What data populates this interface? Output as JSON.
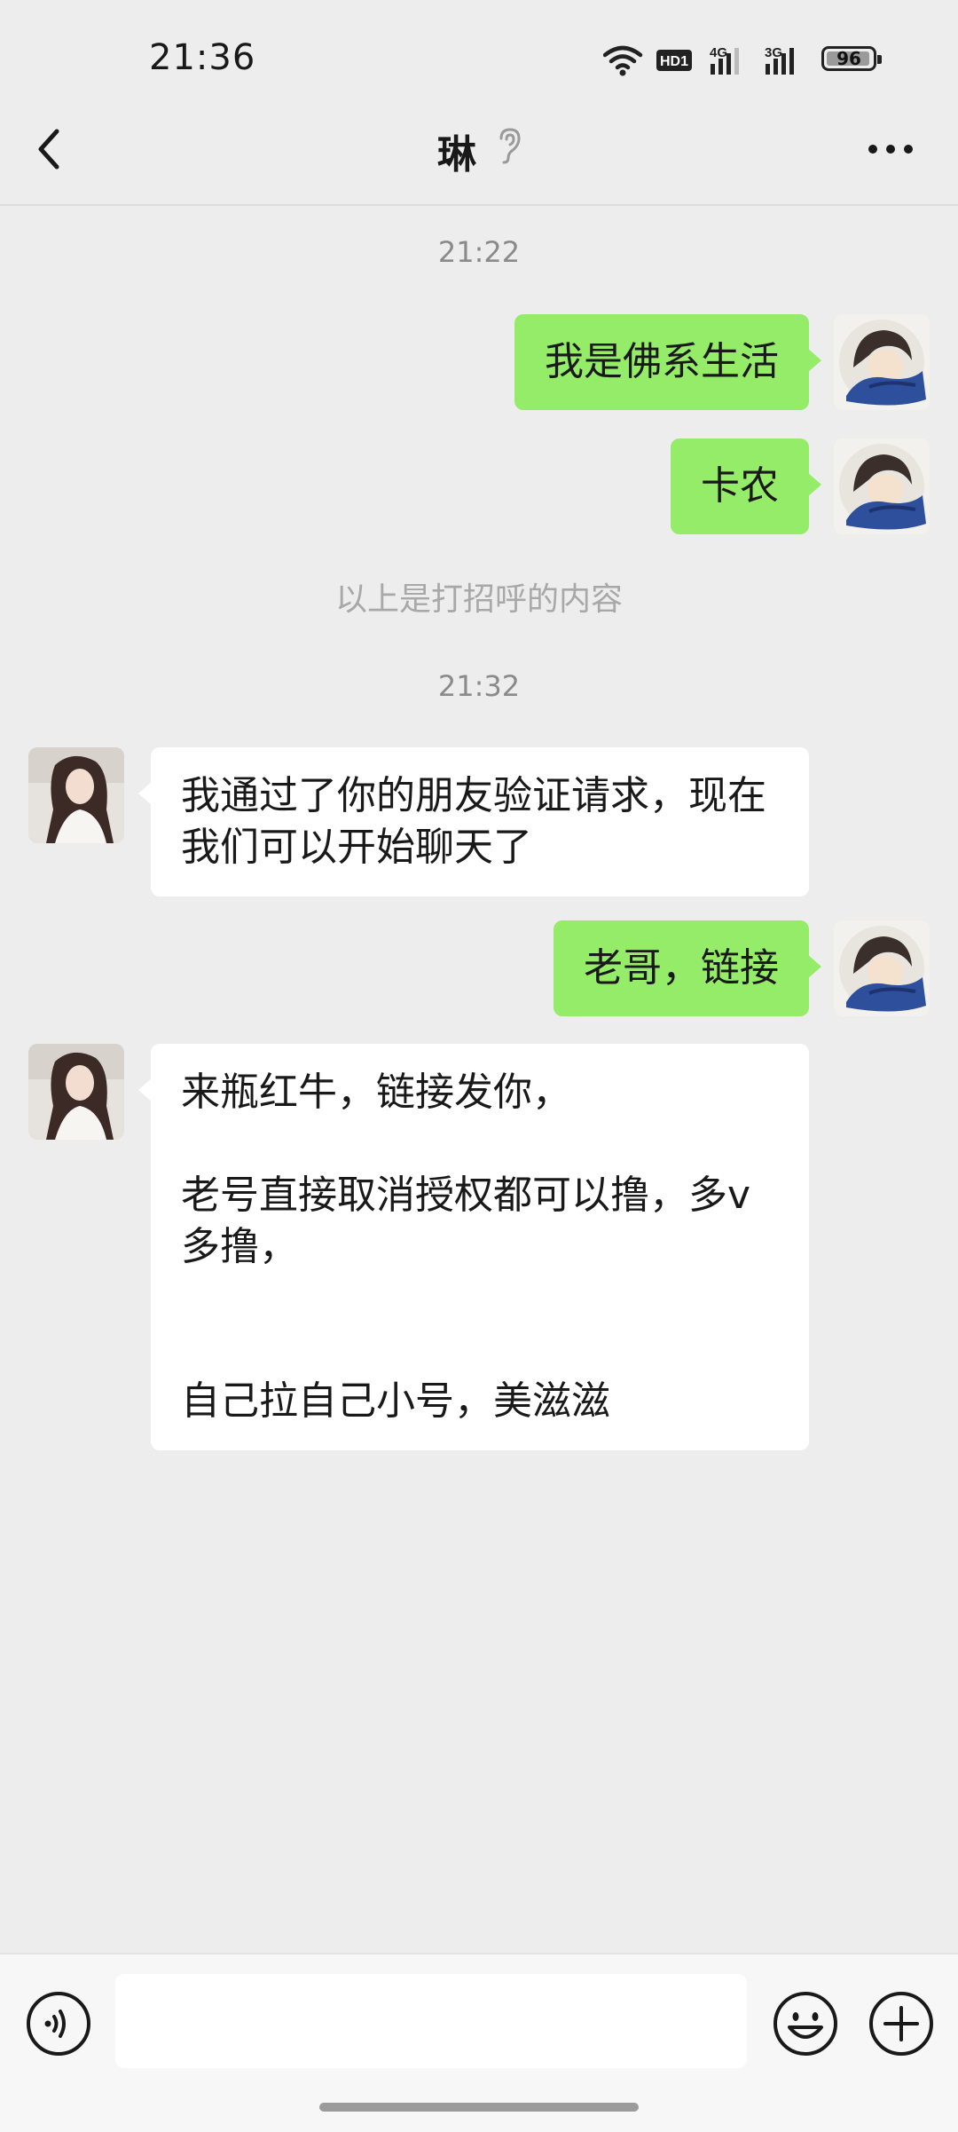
{
  "status_bar": {
    "time": "21:36",
    "network_badge": "HD1",
    "signal_1": "4G",
    "signal_2": "3G",
    "battery": "96",
    "icons": [
      "wifi-icon",
      "hd-icon",
      "signal-4g-icon",
      "signal-3g-icon",
      "battery-icon"
    ]
  },
  "nav": {
    "title": "琳",
    "back_icon": "chevron-left-icon",
    "ear_icon": "earpiece-mode-icon",
    "more_icon": "more-dots-icon"
  },
  "chat": {
    "timestamp_1": "21:22",
    "msg_1": "我是佛系生活",
    "msg_2": "卡农",
    "system_note": "以上是打招呼的内容",
    "timestamp_2": "21:32",
    "msg_3": "我通过了你的朋友验证请求，现在我们可以开始聊天了",
    "msg_4": "老哥，链接",
    "msg_5": "来瓶红牛，链接发你，\n\n老号直接取消授权都可以撸，多v多撸，\n\n\n自己拉自己小号，美滋滋"
  },
  "input_bar": {
    "value": "",
    "voice_icon": "voice-icon",
    "emoji_icon": "emoji-icon",
    "plus_icon": "plus-icon"
  },
  "colors": {
    "background": "#ededed",
    "outgoing_bubble": "#95ec69",
    "incoming_bubble": "#ffffff"
  }
}
